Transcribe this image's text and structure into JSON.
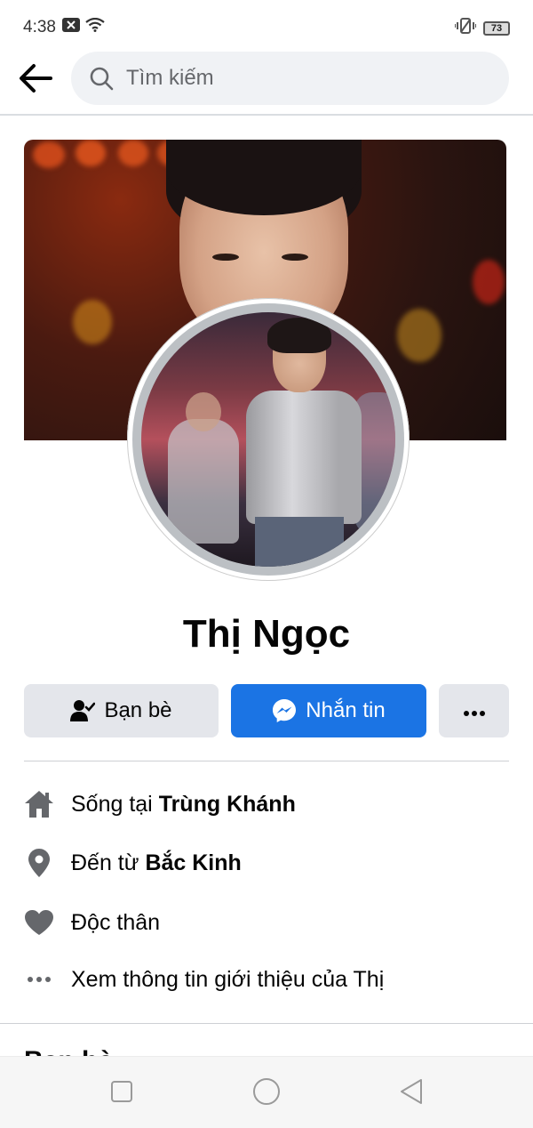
{
  "status_bar": {
    "time": "4:38",
    "battery": "73"
  },
  "search": {
    "placeholder": "Tìm kiếm"
  },
  "profile": {
    "name": "Thị Ngọc"
  },
  "actions": {
    "friends_label": "Bạn bè",
    "message_label": "Nhắn tin",
    "more_label": "···"
  },
  "intro": {
    "lives_prefix": "Sống tại ",
    "lives_place": "Trùng Khánh",
    "from_prefix": "Đến từ ",
    "from_place": "Bắc Kinh",
    "relationship": "Độc thân",
    "see_about": "Xem thông tin giới thiệu của Thị"
  },
  "friends_section": {
    "heading": "Bạn bè"
  },
  "colors": {
    "accent": "#1b74e4",
    "button_gray": "#e4e6eb",
    "search_bg": "#f0f2f5",
    "icon_gray": "#65676b"
  },
  "icons": {
    "back": "arrow-left-icon",
    "search": "search-icon",
    "friends": "person-check-icon",
    "messenger": "messenger-icon",
    "home": "home-icon",
    "location": "location-pin-icon",
    "heart": "heart-icon",
    "more_dots": "more-dots-icon"
  }
}
